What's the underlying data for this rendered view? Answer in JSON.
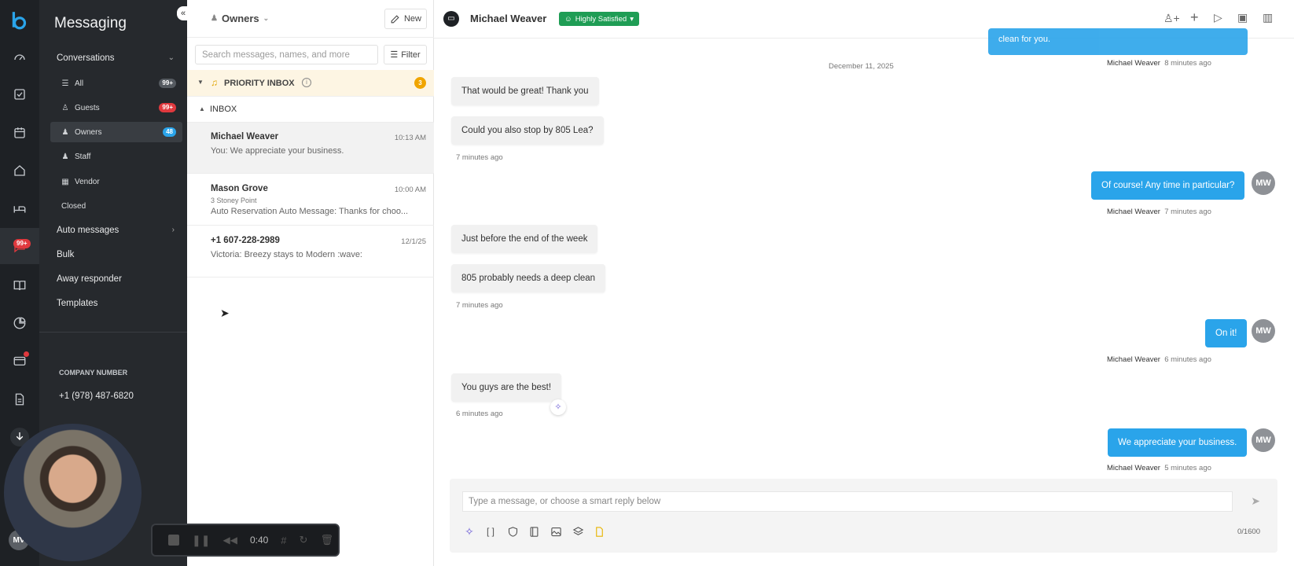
{
  "rail": {
    "badge_messaging": "99+"
  },
  "sidebar": {
    "title": "Messaging",
    "conversations_label": "Conversations",
    "items": [
      {
        "label": "All",
        "count": "99+",
        "count_color": "#555a60"
      },
      {
        "label": "Guests",
        "count": "99+",
        "count_color": "#e0393e"
      },
      {
        "label": "Owners",
        "count": "48",
        "count_color": "#2aa4ea"
      },
      {
        "label": "Staff"
      },
      {
        "label": "Vendor"
      },
      {
        "label": "Closed"
      }
    ],
    "auto_messages": "Auto messages",
    "bulk": "Bulk",
    "away_responder": "Away responder",
    "templates": "Templates",
    "company_number_label": "COMPANY NUMBER",
    "company_number": "+1 (978) 487-6820",
    "user_initials": "MV"
  },
  "list": {
    "owners_label": "Owners",
    "new_label": "New",
    "search_placeholder": "Search messages, names, and more",
    "filter_label": "Filter",
    "priority_label": "PRIORITY INBOX",
    "priority_count": "3",
    "inbox_label": "INBOX",
    "conversations": [
      {
        "name": "Michael Weaver",
        "time": "10:13 AM",
        "sub": "",
        "preview": "You: We appreciate your business."
      },
      {
        "name": "Mason Grove",
        "time": "10:00 AM",
        "sub": "3 Stoney Point",
        "preview": "Auto Reservation Auto Message: Thanks for choo..."
      },
      {
        "name": "+1 607-228-2989",
        "time": "12/1/25",
        "sub": "",
        "preview": "Victoria: Breezy stays to Modern :wave:"
      }
    ]
  },
  "chat": {
    "contact_name": "Michael Weaver",
    "status_label": "Highly Satisfied",
    "status_color": "#1f9d55",
    "top_partial_text": "clean for you.",
    "top_meta_name": "Michael Weaver",
    "top_meta_time": "8 minutes ago",
    "date_divider": "December 11, 2025",
    "messages": [
      {
        "dir": "in",
        "text": "That would be great! Thank you"
      },
      {
        "dir": "in",
        "text": "Could you also stop by 805 Lea?",
        "meta_time": "7 minutes ago"
      },
      {
        "dir": "out",
        "text": "Of course! Any time in particular?",
        "meta_name": "Michael Weaver",
        "meta_time": "7 minutes ago",
        "initials": "MW"
      },
      {
        "dir": "in",
        "text": "Just before the end of the week"
      },
      {
        "dir": "in",
        "text": "805 probably needs a deep clean",
        "meta_time": "7 minutes ago"
      },
      {
        "dir": "out",
        "text": "On it!",
        "meta_name": "Michael Weaver",
        "meta_time": "6 minutes ago",
        "initials": "MW"
      },
      {
        "dir": "in",
        "text": "You guys are the best!",
        "meta_time": "6 minutes ago"
      },
      {
        "dir": "out",
        "text": "We appreciate your business.",
        "meta_name": "Michael Weaver",
        "meta_time": "5 minutes ago",
        "initials": "MW"
      }
    ],
    "composer_placeholder": "Type a message, or choose a smart reply below",
    "char_count": "0/1600"
  },
  "recorder": {
    "time": "0:40"
  }
}
